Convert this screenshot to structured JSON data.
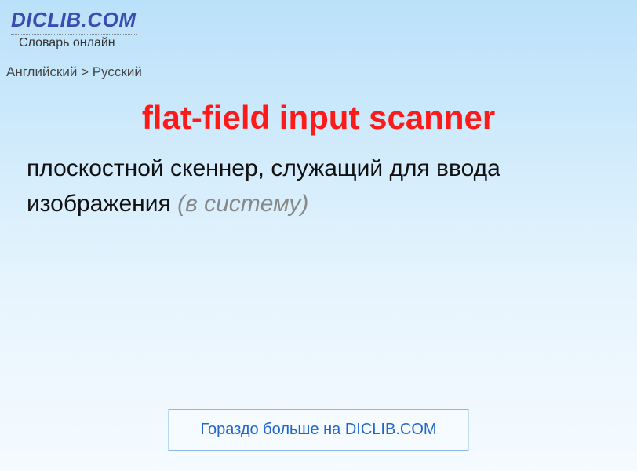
{
  "header": {
    "logo": "DICLIB.COM",
    "tagline": "Словарь онлайн"
  },
  "breadcrumb": {
    "text": "Английский > Русский"
  },
  "entry": {
    "term": "flat-field input scanner",
    "definition_main": "плоскостной скеннер, служащий для ввода изображения ",
    "definition_note": "(в систему)"
  },
  "footer": {
    "link_text": "Гораздо больше на DICLIB.COM"
  }
}
